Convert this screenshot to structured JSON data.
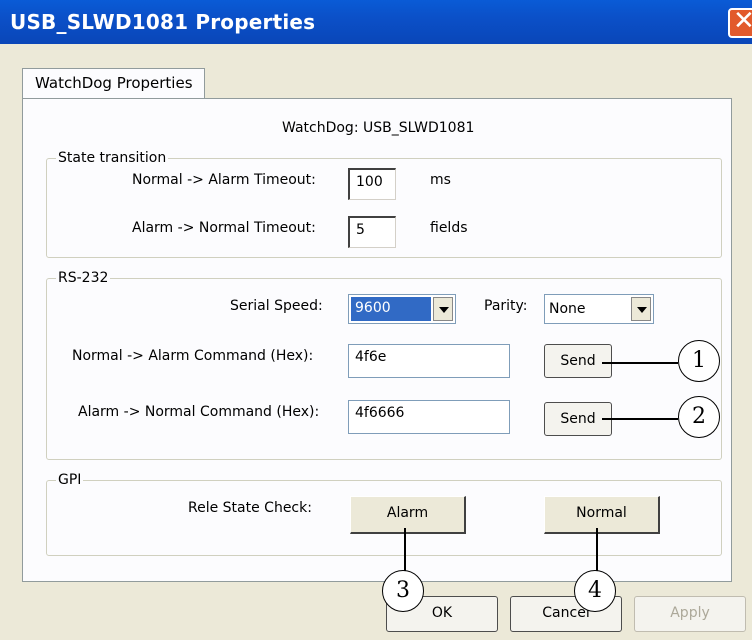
{
  "window": {
    "title": "USB_SLWD1081 Properties"
  },
  "tab": {
    "label": "WatchDog Properties"
  },
  "header": {
    "device": "WatchDog: USB_SLWD1081"
  },
  "state_transition": {
    "title": "State transition",
    "normal_to_alarm_label": "Normal -> Alarm Timeout:",
    "normal_to_alarm_value": "100",
    "normal_to_alarm_unit": "ms",
    "alarm_to_normal_label": "Alarm -> Normal Timeout:",
    "alarm_to_normal_value": "5",
    "alarm_to_normal_unit": "fields"
  },
  "rs232": {
    "title": "RS-232",
    "serial_speed_label": "Serial Speed:",
    "serial_speed_value": "9600",
    "parity_label": "Parity:",
    "parity_value": "None",
    "n2a_cmd_label": "Normal -> Alarm Command (Hex):",
    "n2a_cmd_value": "4f6e",
    "a2n_cmd_label": "Alarm -> Normal Command (Hex):",
    "a2n_cmd_value": "4f6666",
    "send_label": "Send"
  },
  "gpi": {
    "title": "GPI",
    "rele_label": "Rele State Check:",
    "alarm_btn": "Alarm",
    "normal_btn": "Normal"
  },
  "footer": {
    "ok": "OK",
    "cancel": "Cancel",
    "apply": "Apply"
  },
  "callouts": [
    "1",
    "2",
    "3",
    "4"
  ]
}
